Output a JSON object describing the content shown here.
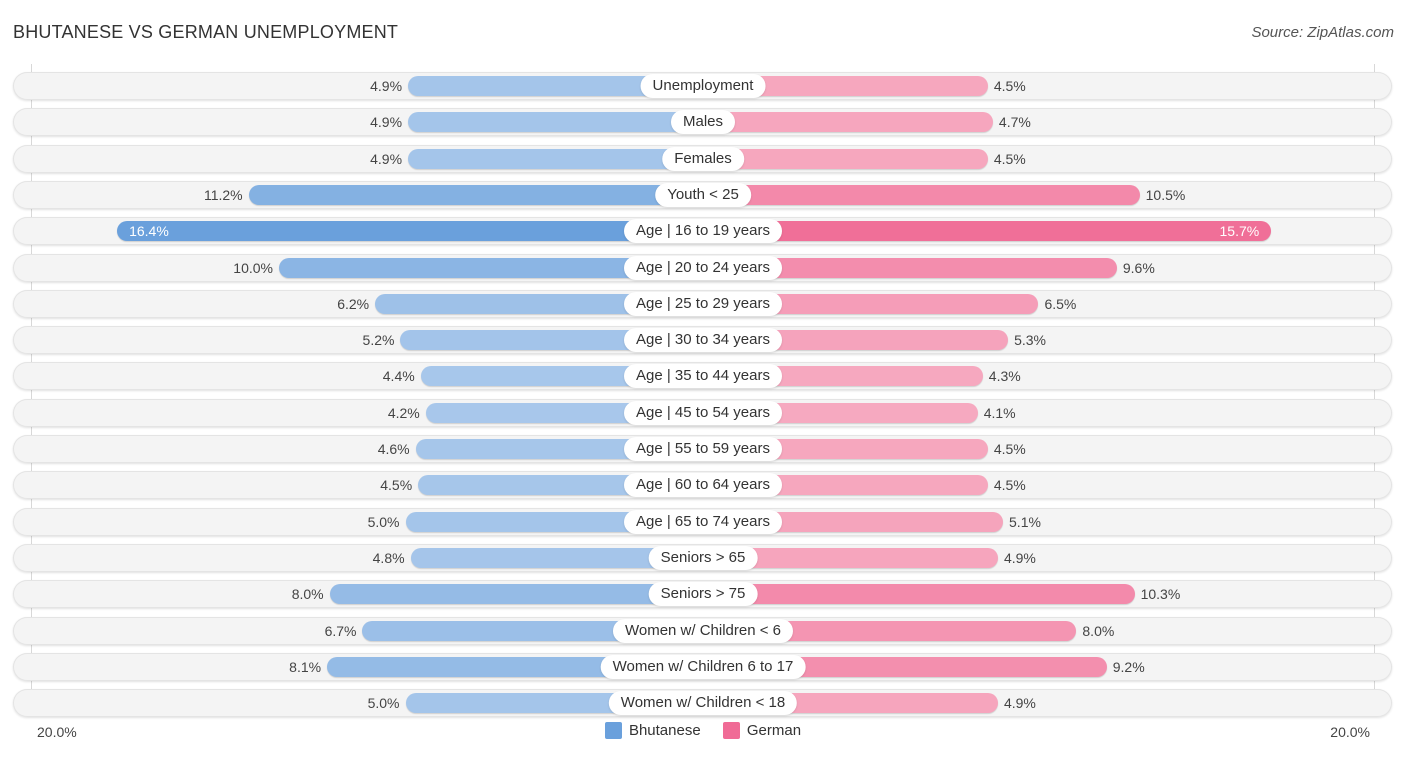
{
  "header": {
    "title": "BHUTANESE VS GERMAN UNEMPLOYMENT",
    "source": "Source: ZipAtlas.com"
  },
  "colors": {
    "bhutanese": "#6aa0dc",
    "bhutanese_light": "#a9c8eb",
    "german": "#f06b96",
    "german_light": "#f6a9c0"
  },
  "chart_data": {
    "type": "bar",
    "orientation": "horizontal-diverging",
    "title": "BHUTANESE VS GERMAN UNEMPLOYMENT",
    "categories": [
      "Unemployment",
      "Males",
      "Females",
      "Youth < 25",
      "Age | 16 to 19 years",
      "Age | 20 to 24 years",
      "Age | 25 to 29 years",
      "Age | 30 to 34 years",
      "Age | 35 to 44 years",
      "Age | 45 to 54 years",
      "Age | 55 to 59 years",
      "Age | 60 to 64 years",
      "Age | 65 to 74 years",
      "Seniors > 65",
      "Seniors > 75",
      "Women w/ Children < 6",
      "Women w/ Children 6 to 17",
      "Women w/ Children < 18"
    ],
    "series": [
      {
        "name": "Bhutanese",
        "side": "left",
        "values": [
          4.9,
          4.9,
          4.9,
          11.2,
          16.4,
          10.0,
          6.2,
          5.2,
          4.4,
          4.2,
          4.6,
          4.5,
          5.0,
          4.8,
          8.0,
          6.7,
          8.1,
          5.0
        ],
        "labels": [
          "4.9%",
          "4.9%",
          "4.9%",
          "11.2%",
          "16.4%",
          "10.0%",
          "6.2%",
          "5.2%",
          "4.4%",
          "4.2%",
          "4.6%",
          "4.5%",
          "5.0%",
          "4.8%",
          "8.0%",
          "6.7%",
          "8.1%",
          "5.0%"
        ]
      },
      {
        "name": "German",
        "side": "right",
        "values": [
          4.5,
          4.7,
          4.5,
          10.5,
          15.7,
          9.6,
          6.5,
          5.3,
          4.3,
          4.1,
          4.5,
          4.5,
          5.1,
          4.9,
          10.3,
          8.0,
          9.2,
          4.9
        ],
        "labels": [
          "4.5%",
          "4.7%",
          "4.5%",
          "10.5%",
          "15.7%",
          "9.6%",
          "6.5%",
          "5.3%",
          "4.3%",
          "4.1%",
          "4.5%",
          "4.5%",
          "5.1%",
          "4.9%",
          "10.3%",
          "8.0%",
          "9.2%",
          "4.9%"
        ]
      }
    ],
    "axis": {
      "left_label": "20.0%",
      "right_label": "20.0%",
      "max": 20.0,
      "unit": "%"
    },
    "legend": {
      "placement": "bottom-center",
      "entries": [
        "Bhutanese",
        "German"
      ]
    },
    "grid": false
  }
}
